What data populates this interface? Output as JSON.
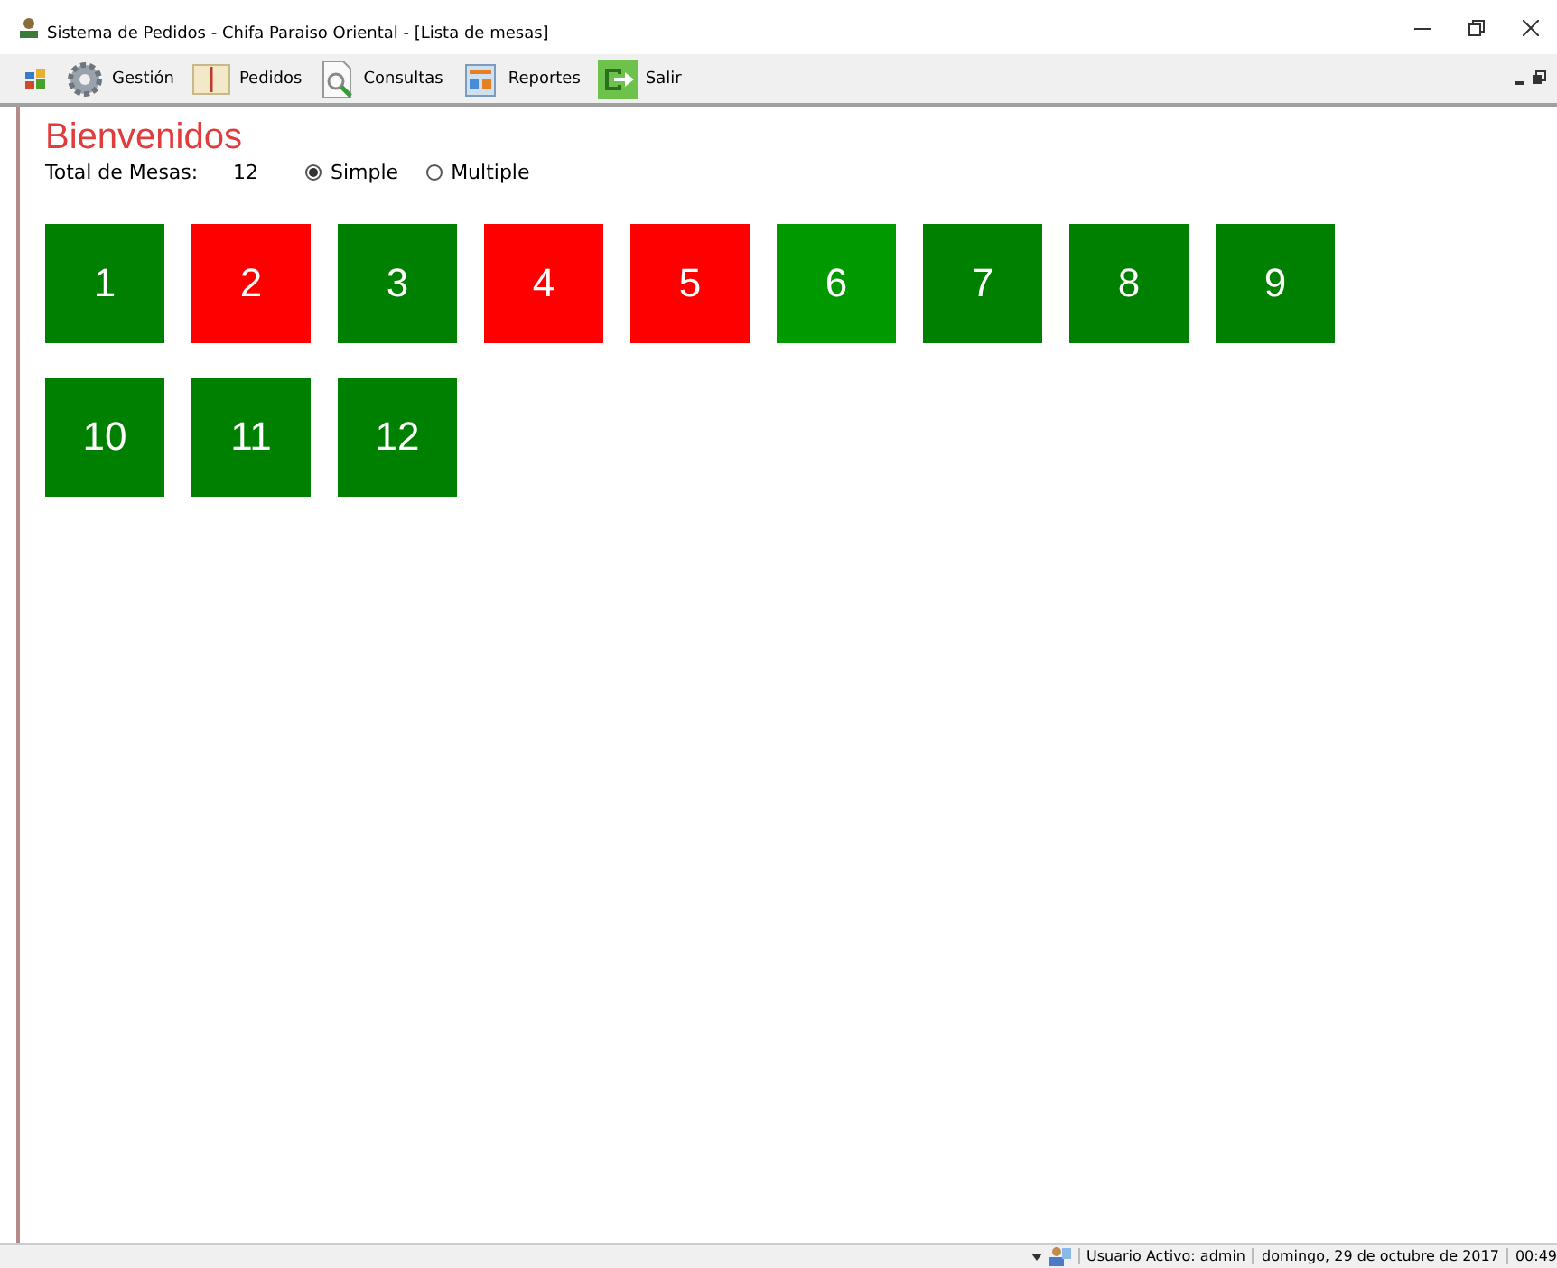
{
  "window": {
    "title": "Sistema de Pedidos - Chifa Paraiso Oriental - [Lista de mesas]"
  },
  "toolbar": [
    {
      "kind": "gear",
      "label": "Gestión"
    },
    {
      "kind": "book",
      "label": "Pedidos"
    },
    {
      "kind": "search",
      "label": "Consultas"
    },
    {
      "kind": "report",
      "label": "Reportes"
    },
    {
      "kind": "exit",
      "label": "Salir"
    }
  ],
  "heading": "Bienvenidos",
  "total": {
    "label": "Total de Mesas:",
    "value": "12"
  },
  "mode": [
    {
      "label": "Simple",
      "selected": true
    },
    {
      "label": "Multiple",
      "selected": false
    }
  ],
  "tables": [
    {
      "number": "1",
      "color": "#008000"
    },
    {
      "number": "2",
      "color": "#ff0000"
    },
    {
      "number": "3",
      "color": "#008000"
    },
    {
      "number": "4",
      "color": "#ff0000"
    },
    {
      "number": "5",
      "color": "#ff0000"
    },
    {
      "number": "6",
      "color": "#009900"
    },
    {
      "number": "7",
      "color": "#008000"
    },
    {
      "number": "8",
      "color": "#008000"
    },
    {
      "number": "9",
      "color": "#008000"
    },
    {
      "number": "10",
      "color": "#008000"
    },
    {
      "number": "11",
      "color": "#008000"
    },
    {
      "number": "12",
      "color": "#008000"
    }
  ],
  "status_bar": {
    "user": "Usuario Activo: admin",
    "date": "domingo, 29 de octubre de 2017",
    "time": "00:49"
  }
}
